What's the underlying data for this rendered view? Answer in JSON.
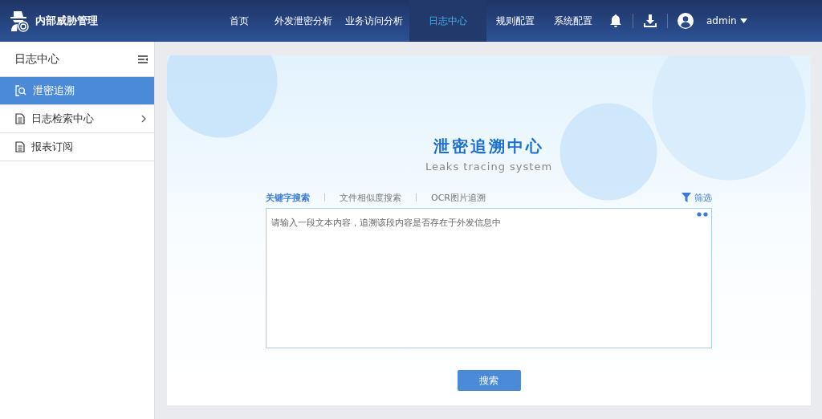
{
  "header": {
    "app_title": "内部威胁管理",
    "nav": [
      {
        "label": "首页",
        "selected": false
      },
      {
        "label": "外发泄密分析",
        "selected": false
      },
      {
        "label": "业务访问分析",
        "selected": false
      },
      {
        "label": "日志中心",
        "selected": true
      },
      {
        "label": "规则配置",
        "selected": false
      },
      {
        "label": "系统配置",
        "selected": false
      }
    ],
    "user": "admin"
  },
  "sidebar": {
    "title": "日志中心",
    "items": [
      {
        "label": "泄密追溯",
        "kind": "search",
        "selected": true,
        "has_children": false
      },
      {
        "label": "日志检索中心",
        "kind": "document",
        "selected": false,
        "has_children": true
      },
      {
        "label": "报表订阅",
        "kind": "document",
        "selected": false,
        "has_children": false
      }
    ]
  },
  "main": {
    "title": "泄密追溯中心",
    "subtitle": "Leaks tracing system",
    "tabs": [
      {
        "label": "关键字搜索",
        "selected": true
      },
      {
        "label": "文件相似度搜索",
        "selected": false
      },
      {
        "label": "OCR图片追溯",
        "selected": false
      }
    ],
    "filter": "筛选",
    "placeholder": "请输入一段文本内容，追溯该段内容是否存在于外发信息中",
    "search_button": "搜索"
  }
}
